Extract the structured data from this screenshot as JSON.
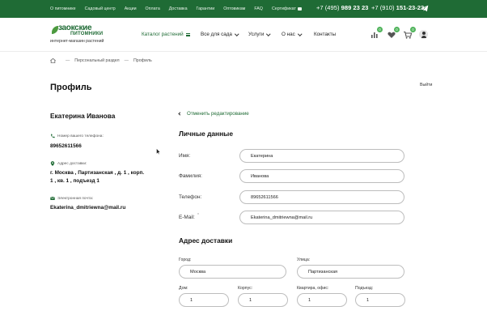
{
  "topbar": {
    "links": [
      "О питомнике",
      "Садовый центр",
      "Акции",
      "Оплата",
      "Доставка",
      "Гарантии",
      "Оптовикам",
      "FAQ",
      "Сертификат"
    ],
    "phone1_prefix": "+7 ",
    "phone1_code": "(495)",
    "phone1_number": " 989 23 23",
    "phone2_prefix": "+7 ",
    "phone2_code": "(910)",
    "phone2_number": " 151-23-23",
    "telegram_icon": "telegram-icon"
  },
  "header": {
    "logo_line1": "заокские",
    "logo_line2": "ПИТОМНИКИ",
    "logo_tagline": "интернет-магазин растений",
    "nav": {
      "catalog": "Каталог растений",
      "garden": "Все для сада",
      "services": "Услуги",
      "about": "О нас",
      "contacts": "Контакты"
    },
    "badges": {
      "compare": "0",
      "favorites": "0",
      "cart": "0"
    }
  },
  "breadcrumb": {
    "personal": "Персональный раздел",
    "profile": "Профиль"
  },
  "page": {
    "title": "Профиль",
    "logout": "Выйти"
  },
  "profile": {
    "name": "Екатерина Иванова",
    "phone_label": "Номер вашего телефона:",
    "phone": "89652611566",
    "address_label": "Адрес доставки:",
    "address_line1": "г. Москва , Партизанская , д. 1 , корп.",
    "address_line2": "1 , кв. 1 , подъезд 1",
    "email_label": "Электронная почта:",
    "email": "Ekaterina_dmitriewna@mail.ru"
  },
  "form": {
    "cancel_label": "Отменить редактирование",
    "personal_heading": "Личные данные",
    "name_label": "Имя:",
    "name_value": "Екатерина",
    "surname_label": "Фамилия:",
    "surname_value": "Иванова",
    "phone_label": "Телефон:",
    "phone_value": "89652611566",
    "email_label": "E-Mail:",
    "email_required": "*",
    "email_value": "Ekaterina_dmitriewna@mail.ru",
    "address_heading": "Адрес доставки",
    "city_label": "Город:",
    "city_value": "Москва",
    "street_label": "Улица:",
    "street_value": "Партизанская",
    "house_label": "Дом:",
    "house_value": "1",
    "building_label": "Корпус:",
    "building_value": "1",
    "apartment_label": "Квартира, офис:",
    "apartment_value": "1",
    "entrance_label": "Подъезд:",
    "entrance_value": "1"
  },
  "colors": {
    "brand": "#1f6b35",
    "badge": "#4fb35a"
  }
}
